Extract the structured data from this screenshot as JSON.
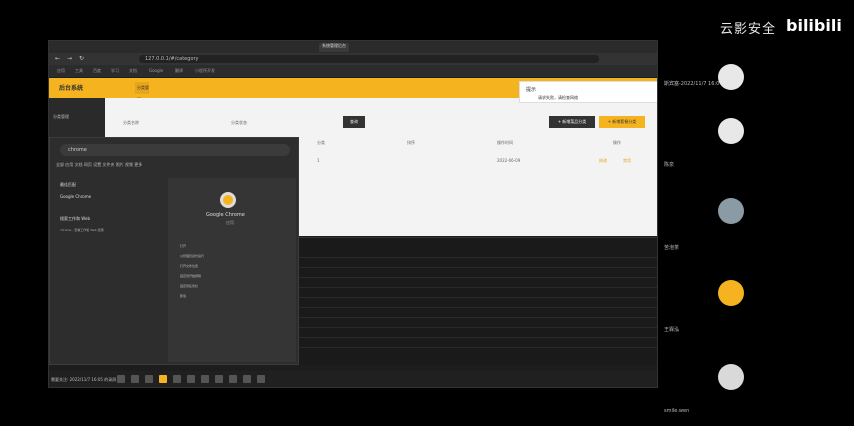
{
  "watermark": {
    "text": "云影安全",
    "logo": "bilibili"
  },
  "browser": {
    "tabs": [
      "",
      "",
      "",
      "",
      "",
      "",
      "系统管理后台",
      "",
      "",
      "",
      "",
      ""
    ],
    "url": "127.0.0.1/#/category",
    "bookmarks": [
      "应用",
      "工具",
      "百度",
      "学习",
      "文档",
      "Google",
      "翻译",
      "小程序开发"
    ]
  },
  "app": {
    "logo_text": "后台系统",
    "tab_label": "分类管理",
    "sidebar_item": "分类管理",
    "filter_label_1": "分类名称",
    "filter_label_2": "分类状态",
    "query_button": "查询",
    "new_button_1": "+ 新增菜品分类",
    "new_button_2": "+ 新增套餐分类",
    "table_headers": [
      "分类",
      "排序",
      "操作时间",
      "操作"
    ],
    "row_values": [
      "1",
      "2022-06-09",
      "修改",
      "禁用"
    ],
    "notification": {
      "title": "提示",
      "message": "请求失败，请检查网络"
    }
  },
  "search_panel": {
    "query": "chrome",
    "tabs": [
      "全部",
      "应用",
      "文档",
      "网页",
      "设置",
      "文件夹",
      "照片",
      "视频",
      "更多"
    ],
    "best_match_title": "最佳匹配",
    "app_name": "Google Chrome",
    "app_type": "应用",
    "web_title": "搜索工作和 Web",
    "web_item": "chrome - 查看工作和 Web 结果",
    "actions": [
      "打开",
      "以管理员身份运行",
      "打开文件位置",
      "固定到开始屏幕",
      "固定到任务栏",
      "卸载"
    ]
  },
  "taskbar": {
    "status": "需要关注: 2022/11/7 16:05 的录屏"
  },
  "participants": [
    {
      "name": "斯宾塞-2022/11/7 16:0"
    },
    {
      "name": "陈泉"
    },
    {
      "name": "苦泡茶"
    },
    {
      "name": "王霖泓"
    },
    {
      "name": "smile.wen"
    }
  ]
}
